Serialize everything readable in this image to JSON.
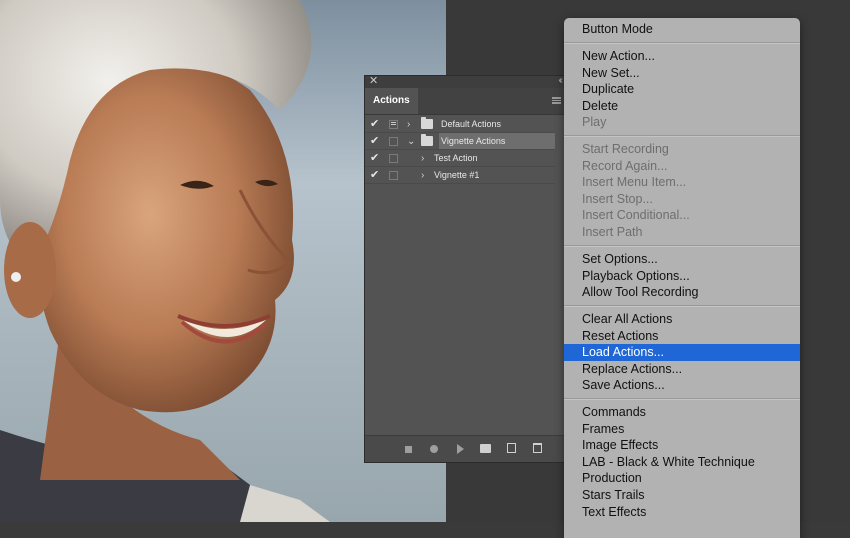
{
  "actions_panel": {
    "tab_label": "Actions",
    "rows": [
      {
        "label": "Default Actions",
        "checked": true,
        "dialog": true,
        "kind": "set",
        "expanded": false
      },
      {
        "label": "Vignette Actions",
        "checked": true,
        "dialog": false,
        "kind": "set",
        "expanded": true
      },
      {
        "label": "Test Action",
        "checked": true,
        "dialog": false,
        "kind": "action",
        "expanded": false
      },
      {
        "label": "Vignette #1",
        "checked": true,
        "dialog": false,
        "kind": "action",
        "expanded": false
      }
    ]
  },
  "flyout_menu": {
    "groups": [
      [
        {
          "label": "Button Mode",
          "enabled": true
        }
      ],
      [
        {
          "label": "New Action...",
          "enabled": true
        },
        {
          "label": "New Set...",
          "enabled": true
        },
        {
          "label": "Duplicate",
          "enabled": true
        },
        {
          "label": "Delete",
          "enabled": true
        },
        {
          "label": "Play",
          "enabled": false
        }
      ],
      [
        {
          "label": "Start Recording",
          "enabled": false
        },
        {
          "label": "Record Again...",
          "enabled": false
        },
        {
          "label": "Insert Menu Item...",
          "enabled": false
        },
        {
          "label": "Insert Stop...",
          "enabled": false
        },
        {
          "label": "Insert Conditional...",
          "enabled": false
        },
        {
          "label": "Insert Path",
          "enabled": false
        }
      ],
      [
        {
          "label": "Set Options...",
          "enabled": true
        },
        {
          "label": "Playback Options...",
          "enabled": true
        },
        {
          "label": "Allow Tool Recording",
          "enabled": true
        }
      ],
      [
        {
          "label": "Clear All Actions",
          "enabled": true
        },
        {
          "label": "Reset Actions",
          "enabled": true
        },
        {
          "label": "Load Actions...",
          "enabled": true,
          "highlighted": true
        },
        {
          "label": "Replace Actions...",
          "enabled": true
        },
        {
          "label": "Save Actions...",
          "enabled": true
        }
      ],
      [
        {
          "label": "Commands",
          "enabled": true
        },
        {
          "label": "Frames",
          "enabled": true
        },
        {
          "label": "Image Effects",
          "enabled": true
        },
        {
          "label": "LAB - Black & White Technique",
          "enabled": true
        },
        {
          "label": "Production",
          "enabled": true
        },
        {
          "label": "Stars Trails",
          "enabled": true
        },
        {
          "label": "Text Effects",
          "enabled": true
        }
      ]
    ]
  },
  "icons": {
    "panel_close": "close-icon",
    "panel_collapse": "collapse-icon",
    "panel_menu": "panel-menu-icon",
    "footer": [
      "stop-icon",
      "record-icon",
      "play-icon",
      "new-set-icon",
      "new-action-icon",
      "trash-icon"
    ]
  },
  "colors": {
    "menu_highlight": "#1f66d6",
    "menu_bg": "#b2b2b2",
    "panel_bg": "#535353"
  }
}
